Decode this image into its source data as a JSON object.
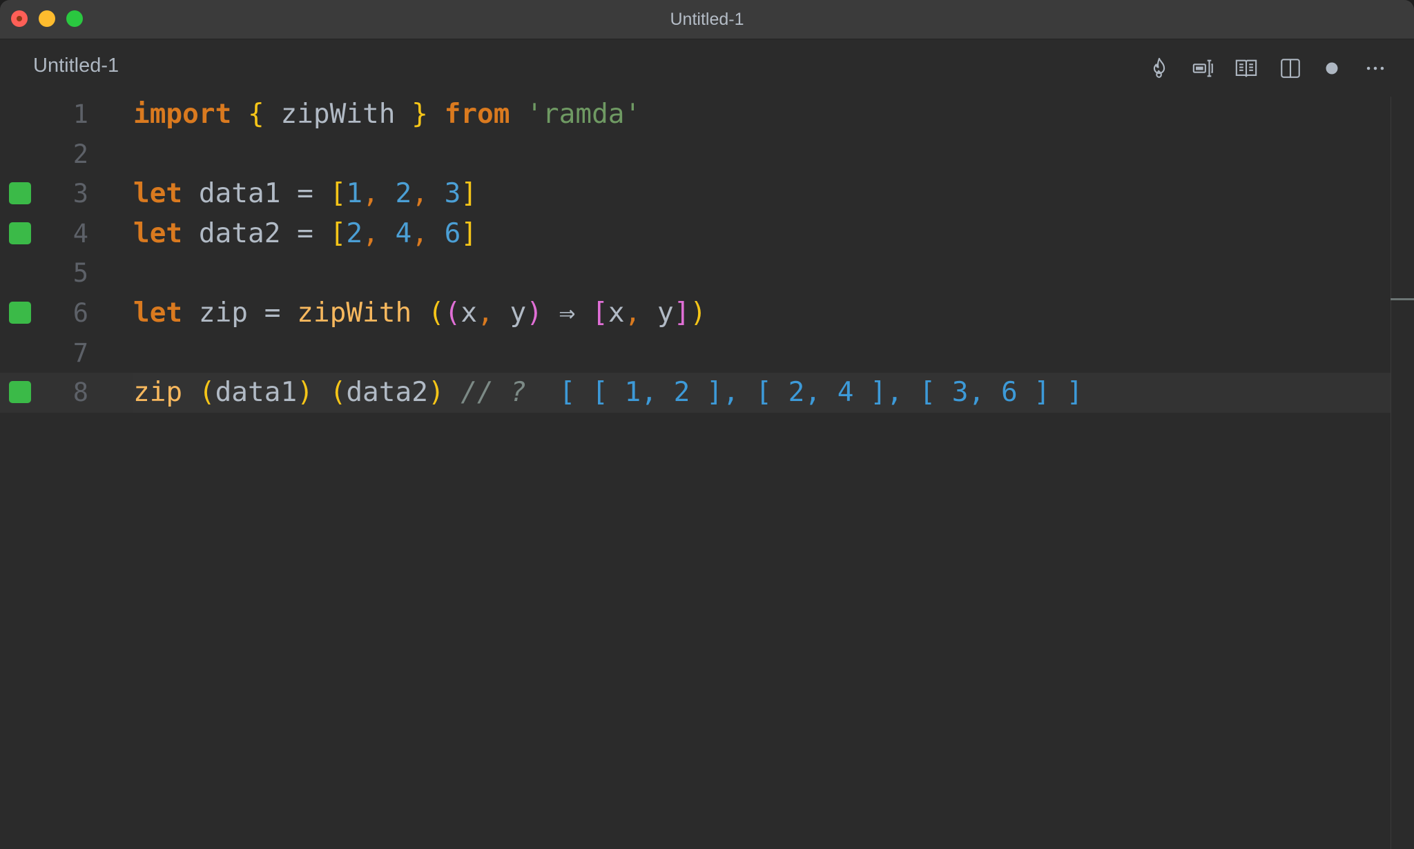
{
  "window": {
    "title": "Untitled-1"
  },
  "tab": {
    "label": "Untitled-1"
  },
  "actions": [
    {
      "name": "flame-icon",
      "label": "Quokka"
    },
    {
      "name": "rename-icon",
      "label": "Rename"
    },
    {
      "name": "book-icon",
      "label": "Open Preview"
    },
    {
      "name": "split-editor-icon",
      "label": "Split Editor"
    },
    {
      "name": "unsaved-dot-icon",
      "label": "Unsaved"
    },
    {
      "name": "more-icon",
      "label": "More Actions"
    }
  ],
  "editor": {
    "current_line": 8,
    "lines": [
      {
        "number": "1",
        "marker": false,
        "tokens": [
          {
            "t": "import",
            "c": "kw"
          },
          {
            "t": " ",
            "c": "op"
          },
          {
            "t": "{",
            "c": "br1"
          },
          {
            "t": " zipWith ",
            "c": "op"
          },
          {
            "t": "}",
            "c": "br1"
          },
          {
            "t": " ",
            "c": "op"
          },
          {
            "t": "from",
            "c": "kw"
          },
          {
            "t": " ",
            "c": "op"
          },
          {
            "t": "'ramda'",
            "c": "str"
          }
        ]
      },
      {
        "number": "2",
        "marker": false,
        "tokens": []
      },
      {
        "number": "3",
        "marker": true,
        "tokens": [
          {
            "t": "let",
            "c": "kw"
          },
          {
            "t": " data1 = ",
            "c": "op"
          },
          {
            "t": "[",
            "c": "br1"
          },
          {
            "t": "1",
            "c": "num"
          },
          {
            "t": ",",
            "c": "punc"
          },
          {
            "t": " ",
            "c": "op"
          },
          {
            "t": "2",
            "c": "num"
          },
          {
            "t": ",",
            "c": "punc"
          },
          {
            "t": " ",
            "c": "op"
          },
          {
            "t": "3",
            "c": "num"
          },
          {
            "t": "]",
            "c": "br1"
          }
        ]
      },
      {
        "number": "4",
        "marker": true,
        "tokens": [
          {
            "t": "let",
            "c": "kw"
          },
          {
            "t": " data2 = ",
            "c": "op"
          },
          {
            "t": "[",
            "c": "br1"
          },
          {
            "t": "2",
            "c": "num"
          },
          {
            "t": ",",
            "c": "punc"
          },
          {
            "t": " ",
            "c": "op"
          },
          {
            "t": "4",
            "c": "num"
          },
          {
            "t": ",",
            "c": "punc"
          },
          {
            "t": " ",
            "c": "op"
          },
          {
            "t": "6",
            "c": "num"
          },
          {
            "t": "]",
            "c": "br1"
          }
        ]
      },
      {
        "number": "5",
        "marker": false,
        "tokens": []
      },
      {
        "number": "6",
        "marker": true,
        "tokens": [
          {
            "t": "let",
            "c": "kw"
          },
          {
            "t": " zip = ",
            "c": "op"
          },
          {
            "t": "zipWith",
            "c": "fn"
          },
          {
            "t": " ",
            "c": "op"
          },
          {
            "t": "(",
            "c": "br1"
          },
          {
            "t": "(",
            "c": "br2"
          },
          {
            "t": "x",
            "c": "op"
          },
          {
            "t": ",",
            "c": "punc"
          },
          {
            "t": " y",
            "c": "op"
          },
          {
            "t": ")",
            "c": "br2"
          },
          {
            "t": " ⇒ ",
            "c": "op"
          },
          {
            "t": "[",
            "c": "br2"
          },
          {
            "t": "x",
            "c": "op"
          },
          {
            "t": ",",
            "c": "punc"
          },
          {
            "t": " y",
            "c": "op"
          },
          {
            "t": "]",
            "c": "br2"
          },
          {
            "t": ")",
            "c": "br1"
          }
        ]
      },
      {
        "number": "7",
        "marker": false,
        "tokens": []
      },
      {
        "number": "8",
        "marker": true,
        "tokens": [
          {
            "t": "zip",
            "c": "fn"
          },
          {
            "t": " ",
            "c": "op"
          },
          {
            "t": "(",
            "c": "br1"
          },
          {
            "t": "data1",
            "c": "op"
          },
          {
            "t": ")",
            "c": "br1"
          },
          {
            "t": " ",
            "c": "op"
          },
          {
            "t": "(",
            "c": "br1"
          },
          {
            "t": "data2",
            "c": "op"
          },
          {
            "t": ")",
            "c": "br1"
          },
          {
            "t": " // ?",
            "c": "cmt"
          },
          {
            "t": "  [ [ 1, 2 ], [ 2, 4 ], [ 3, 6 ] ]",
            "c": "res"
          }
        ]
      }
    ]
  },
  "colors": {
    "marker_green": "#3bba48",
    "keyword": "#da7a1f",
    "function": "#f7b85e",
    "bracket_1": "#f5c518",
    "bracket_2": "#e06fd6",
    "number": "#4b9fd5",
    "string": "#6f9a63",
    "result": "#3d9ad8"
  }
}
